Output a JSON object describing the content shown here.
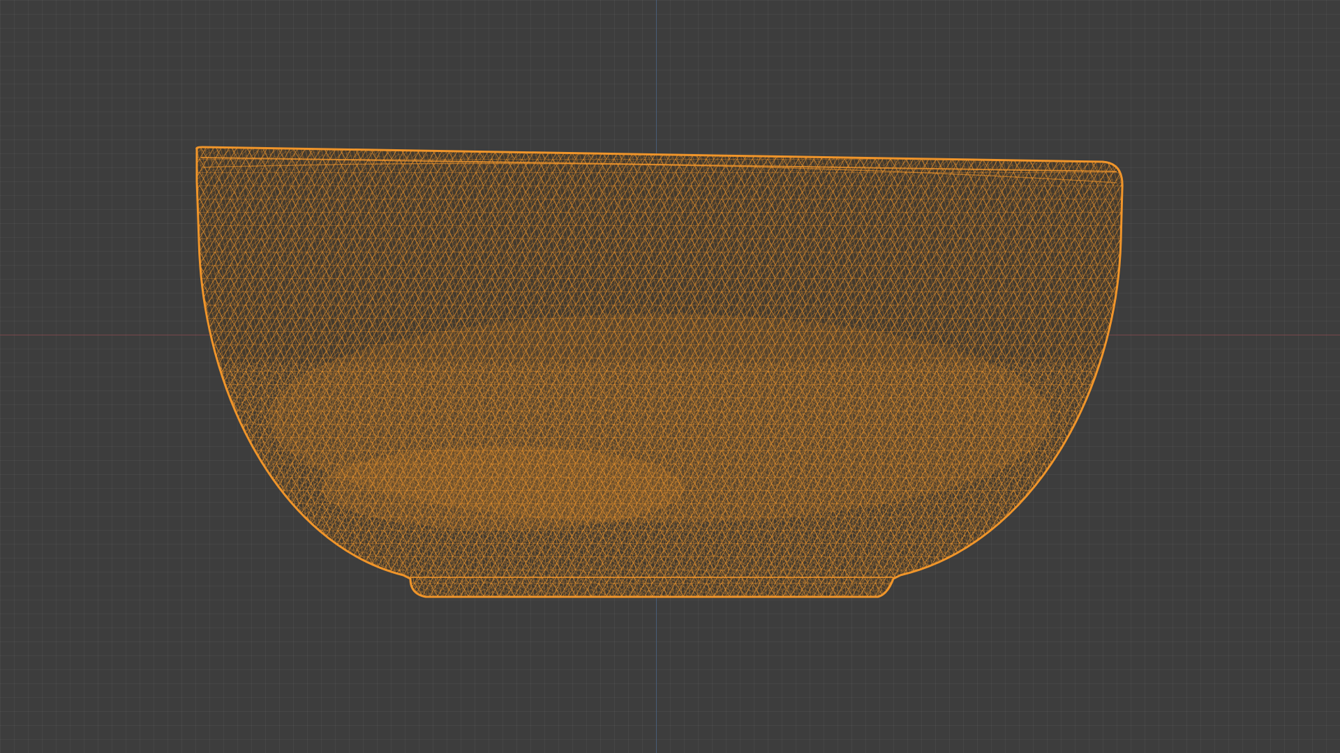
{
  "viewport": {
    "background_color": "#3d3d3d",
    "grid_visible": true,
    "x_axis_color": "#8a4a4e",
    "z_axis_color": "#4a6487"
  },
  "object": {
    "shape": "bowl",
    "display_mode": "wireframe",
    "wire_color": "#f0952a",
    "selected": true
  }
}
